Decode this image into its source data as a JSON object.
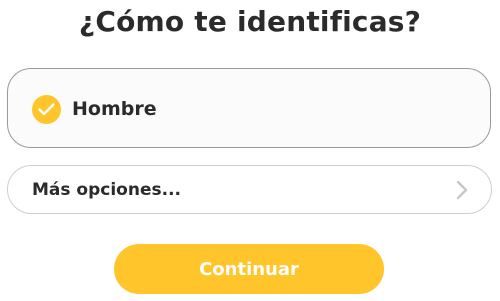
{
  "header": {
    "title": "¿Cómo te identificas?"
  },
  "options": {
    "selected": {
      "label": "Hombre",
      "checked": true,
      "icon": "checkmark-icon"
    }
  },
  "more_options": {
    "label": "Más opciones...",
    "icon": "chevron-right-icon"
  },
  "actions": {
    "continue_label": "Continuar"
  },
  "colors": {
    "accent": "#ffc52a",
    "text": "#2b2b2b",
    "card_border": "#9a9a9a",
    "row_border": "#cfcfcf",
    "chevron": "#c8c8c8"
  }
}
